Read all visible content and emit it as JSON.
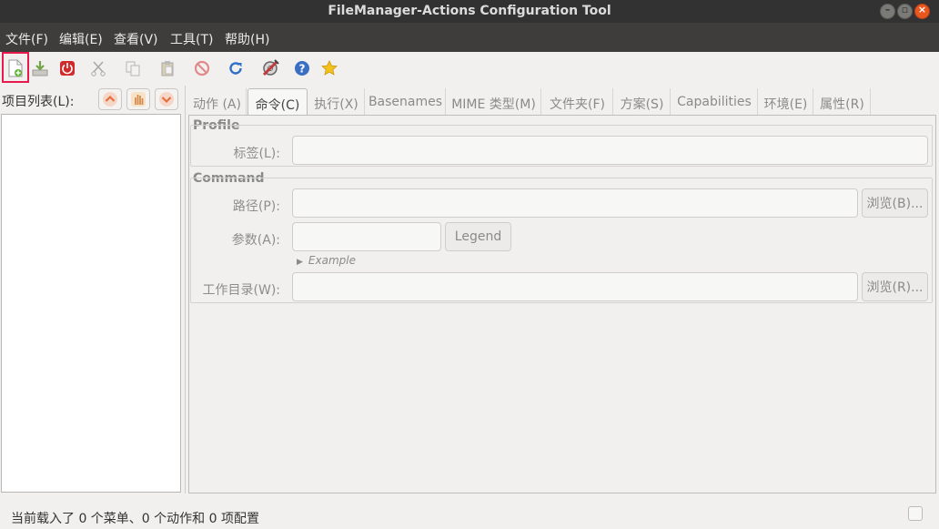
{
  "window": {
    "title": "FileManager-Actions Configuration Tool"
  },
  "menubar": [
    {
      "label": "文件(F)"
    },
    {
      "label": "编辑(E)"
    },
    {
      "label": "查看(V)"
    },
    {
      "label": "工具(T)"
    },
    {
      "label": "帮助(H)"
    }
  ],
  "toolbar": {
    "icons": [
      "new-menu-icon",
      "save-icon",
      "quit-icon",
      "cut-icon",
      "copy-icon",
      "paste-icon",
      "delete-icon",
      "reload-icon",
      "preferences-icon",
      "help-icon",
      "about-icon"
    ]
  },
  "left": {
    "label": "项目列表(L):"
  },
  "tabs": [
    {
      "label": "动作 (A)"
    },
    {
      "label": "命令(C)"
    },
    {
      "label": "执行(X)"
    },
    {
      "label": "Basenames"
    },
    {
      "label": "MIME 类型(M)"
    },
    {
      "label": "文件夹(F)"
    },
    {
      "label": "方案(S)"
    },
    {
      "label": "Capabilities"
    },
    {
      "label": "环境(E)"
    },
    {
      "label": "属性(R)"
    }
  ],
  "command_tab": {
    "profile_section": "Profile",
    "label_field": {
      "label": "标签(L):",
      "value": ""
    },
    "command_section": "Command",
    "path_field": {
      "label": "路径(P):",
      "value": "",
      "browse": "浏览(B)..."
    },
    "params_field": {
      "label": "参数(A):",
      "value": "",
      "legend": "Legend"
    },
    "example": "Example",
    "workdir_field": {
      "label": "工作目录(W):",
      "value": "",
      "browse": "浏览(R)..."
    }
  },
  "status": {
    "text": "当前载入了 0 个菜单、0 个动作和 0 项配置"
  }
}
